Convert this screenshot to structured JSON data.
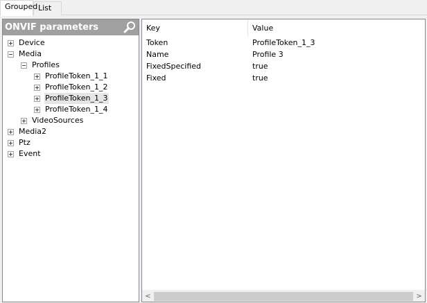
{
  "tabs": [
    {
      "label": "Grouped",
      "active": true
    },
    {
      "label": "List",
      "active": false
    }
  ],
  "left_panel": {
    "title": "ONVIF parameters",
    "search_icon": "search-icon",
    "tree": [
      {
        "label": "Device",
        "expanded": false
      },
      {
        "label": "Media",
        "expanded": true
      },
      {
        "label": "Profiles",
        "expanded": true
      },
      {
        "label": "ProfileToken_1_1",
        "expanded": false
      },
      {
        "label": "ProfileToken_1_2",
        "expanded": false
      },
      {
        "label": "ProfileToken_1_3",
        "expanded": false,
        "selected": true
      },
      {
        "label": "ProfileToken_1_4",
        "expanded": false
      },
      {
        "label": "VideoSources",
        "expanded": false
      },
      {
        "label": "Media2",
        "expanded": false
      },
      {
        "label": "Ptz",
        "expanded": false
      },
      {
        "label": "Event",
        "expanded": false
      }
    ]
  },
  "right_panel": {
    "columns": {
      "key": "Key",
      "value": "Value"
    },
    "rows": [
      {
        "key": "Token",
        "value": "ProfileToken_1_3"
      },
      {
        "key": "Name",
        "value": "Profile 3"
      },
      {
        "key": "FixedSpecified",
        "value": "true"
      },
      {
        "key": "Fixed",
        "value": "true"
      }
    ],
    "scrollbar": {
      "left_arrow": "<",
      "right_arrow": ">"
    }
  },
  "colors": {
    "header_bg": "#a0a0a0",
    "selection_bg": "#e5e5e5",
    "panel_border": "#828790"
  }
}
